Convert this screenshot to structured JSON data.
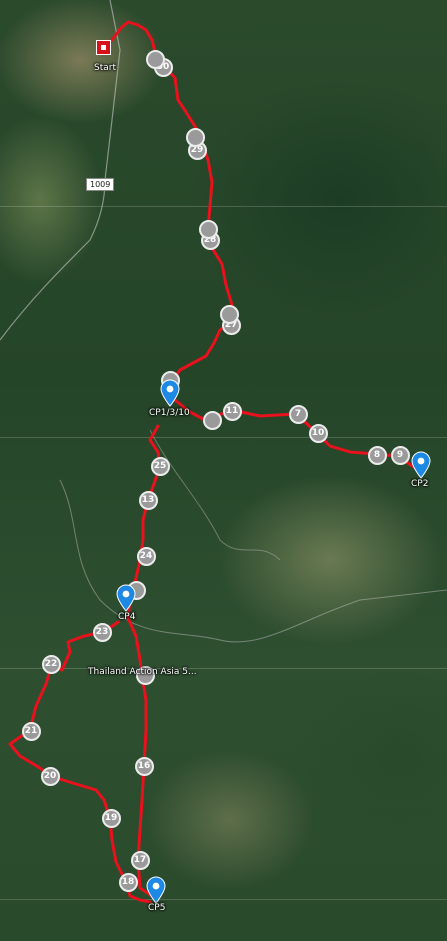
{
  "start_label": "Start",
  "road_shield": "1009",
  "route_color": "#e8111c",
  "pin_color": "#1e88e5",
  "route_name": "Thailand Action Asia 5...",
  "checkpoints": [
    "CP1/3/10",
    "CP2",
    "CP4",
    "CP5"
  ],
  "waypoint_numbers": [
    "30",
    "29",
    "28",
    "27",
    "11",
    "7",
    "10",
    "8",
    "9",
    "25",
    "13",
    "24",
    "23",
    "22",
    "21",
    "20",
    "19",
    "17",
    "18",
    "16"
  ]
}
